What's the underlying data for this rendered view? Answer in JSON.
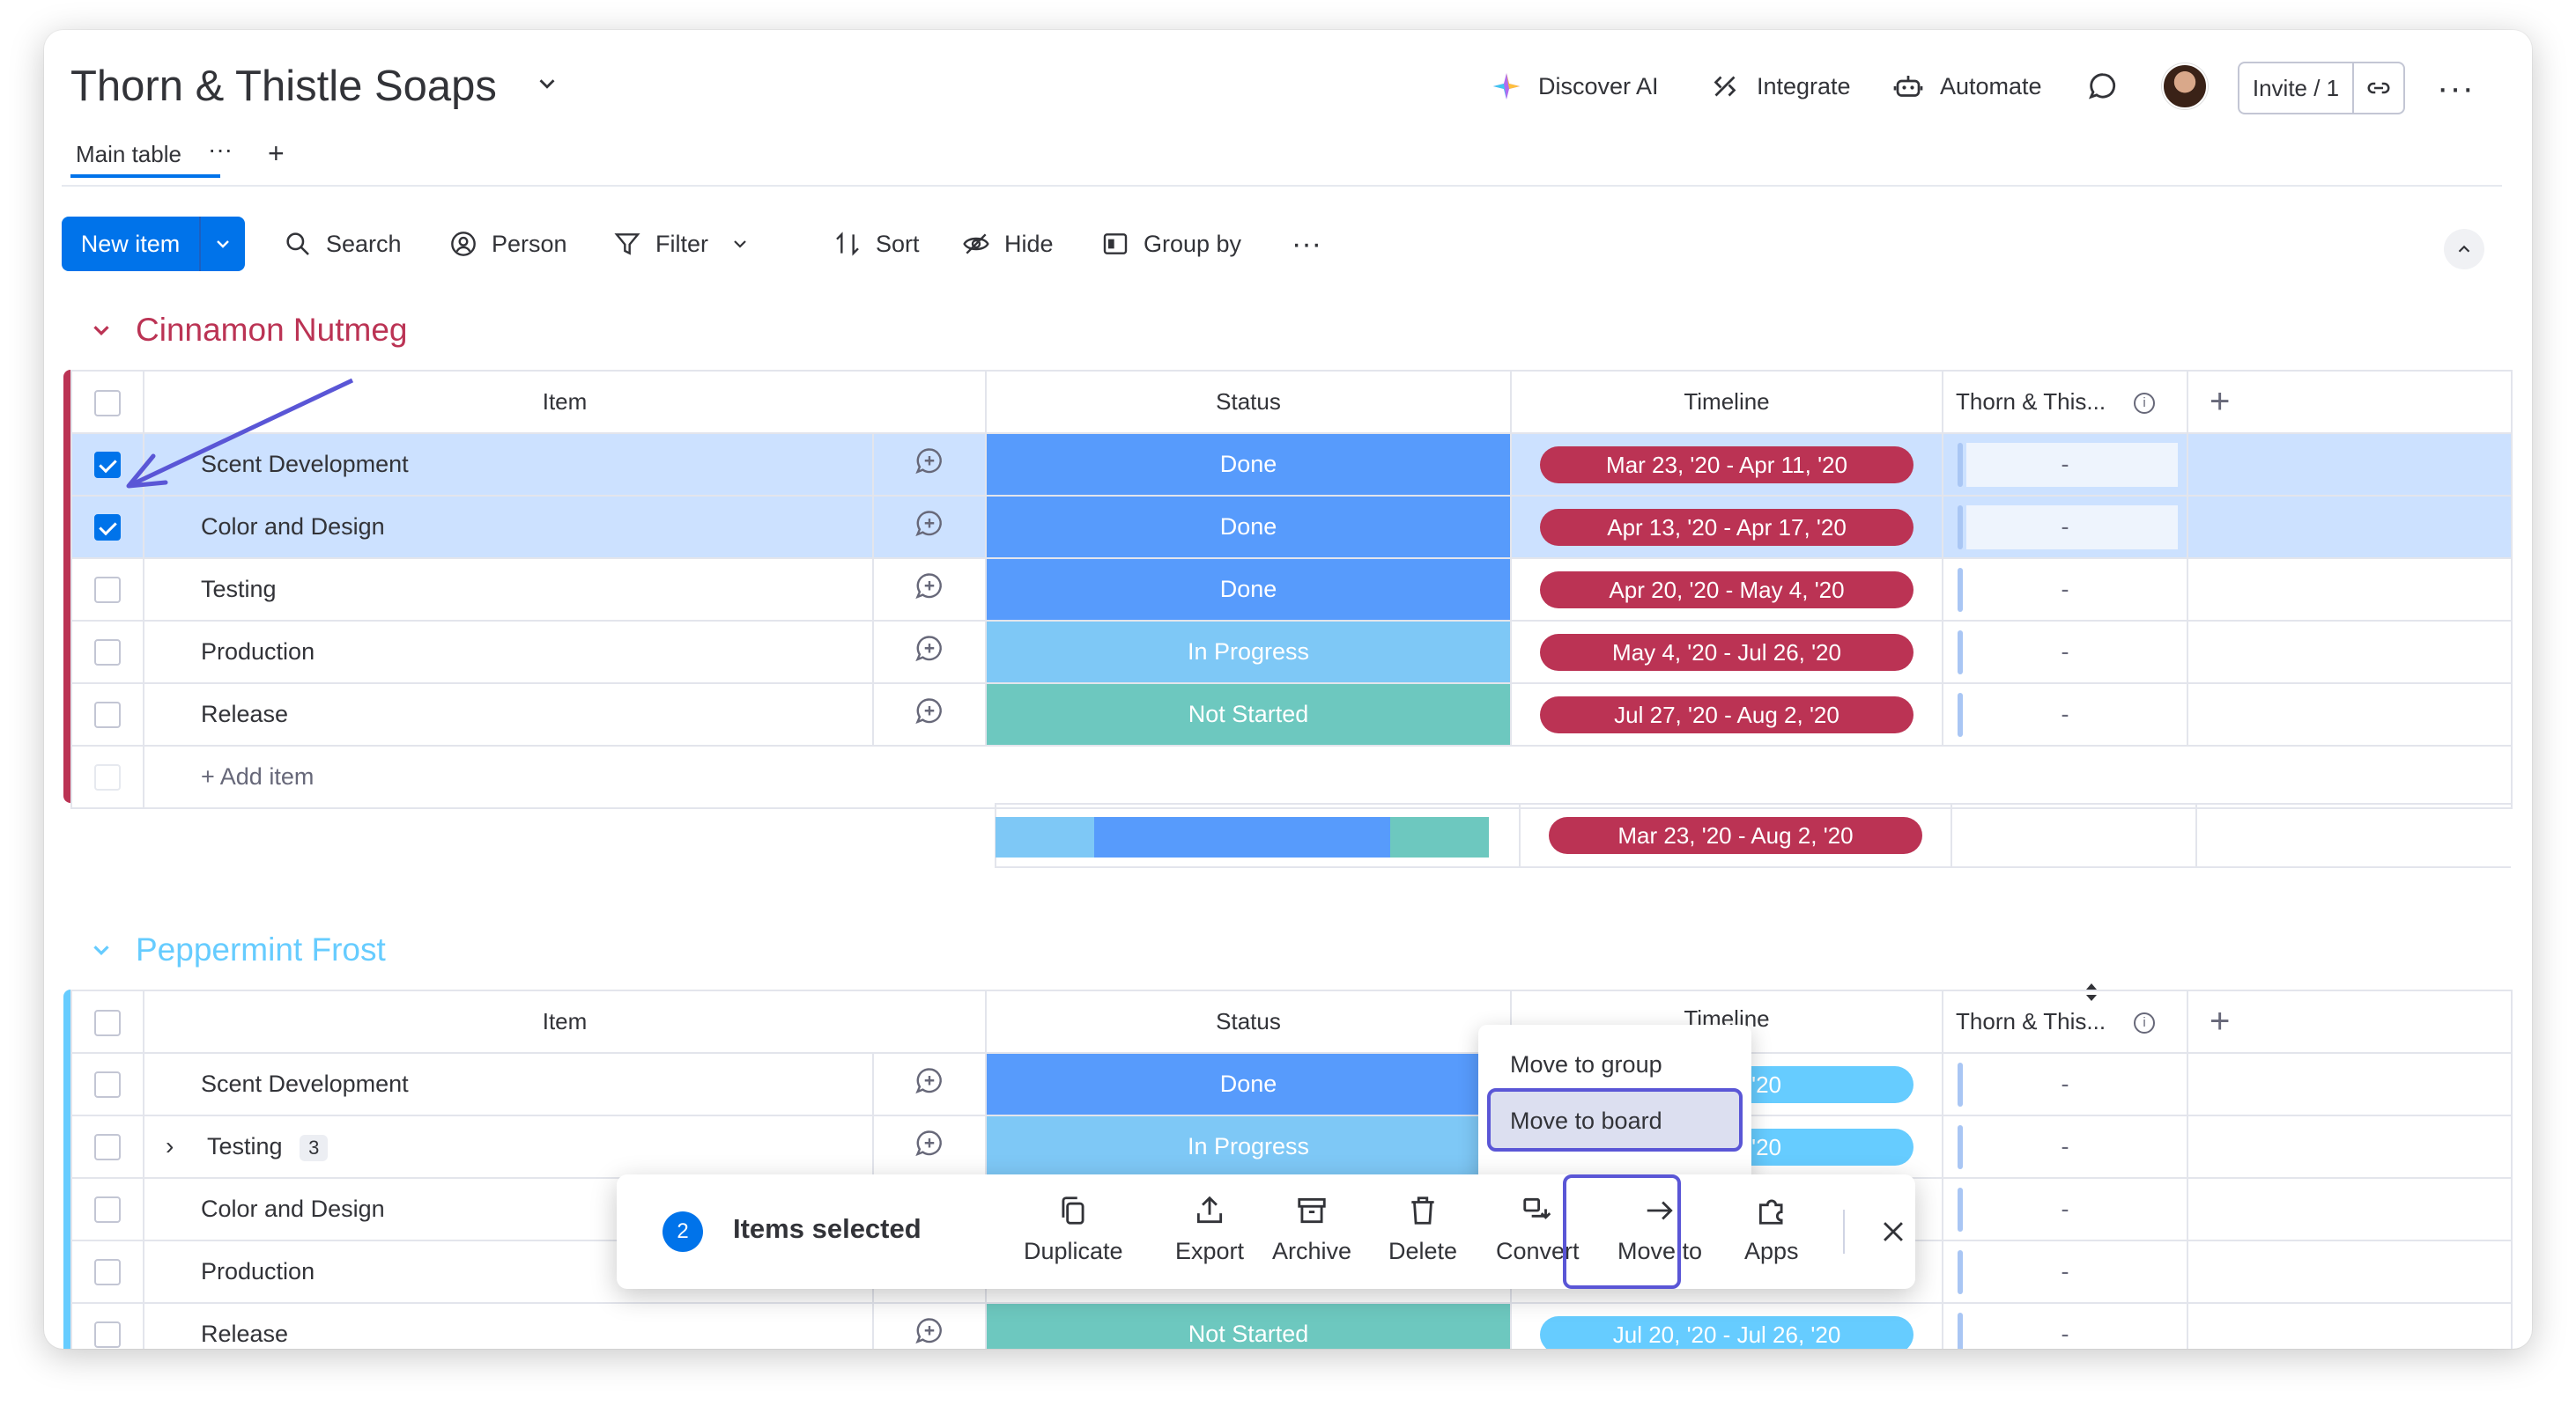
{
  "board": {
    "title": "Thorn & Thistle Soaps"
  },
  "top_actions": {
    "discover_ai": "Discover AI",
    "integrate": "Integrate",
    "automate": "Automate",
    "invite": "Invite / 1"
  },
  "tabs": [
    {
      "label": "Main table"
    }
  ],
  "toolbar": {
    "new_item": "New item",
    "search": "Search",
    "person": "Person",
    "filter": "Filter",
    "sort": "Sort",
    "hide": "Hide",
    "group_by": "Group by"
  },
  "columns": {
    "item": "Item",
    "status": "Status",
    "timeline": "Timeline",
    "dependency": "Thorn & This..."
  },
  "colors": {
    "accent": "#0073ea",
    "done": "#579bfc",
    "in_progress": "#7ec8f6",
    "not_started": "#6dc8bf",
    "group1": "#bb3354",
    "group2": "#66ccff",
    "timeline_red": "#bb3354",
    "timeline_blue": "#66ccff",
    "highlight": "#5a56d6"
  },
  "groups": [
    {
      "title": "Cinnamon Nutmeg",
      "rows": [
        {
          "name": "Scent Development",
          "status": "Done",
          "timeline": "Mar 23, '20 - Apr 11, '20",
          "dep": "-",
          "selected": true
        },
        {
          "name": "Color and Design",
          "status": "Done",
          "timeline": "Apr 13, '20 - Apr 17, '20",
          "dep": "-",
          "selected": true
        },
        {
          "name": "Testing",
          "status": "Done",
          "timeline": "Apr 20, '20 - May 4, '20",
          "dep": "-",
          "selected": false
        },
        {
          "name": "Production",
          "status": "In Progress",
          "timeline": "May 4, '20 - Jul 26, '20",
          "dep": "-",
          "selected": false
        },
        {
          "name": "Release",
          "status": "Not Started",
          "timeline": "Jul 27, '20 - Aug 2, '20",
          "dep": "-",
          "selected": false
        }
      ],
      "add_item": "+ Add item",
      "summary_timeline": "Mar 23, '20 - Aug 2, '20"
    },
    {
      "title": "Peppermint Frost",
      "timeline_header": "Timeline",
      "rows": [
        {
          "name": "Scent Development",
          "status": "Done",
          "timeline": "ay 1, '20",
          "dep": "-"
        },
        {
          "name": "Testing",
          "subitems": "3",
          "status": "In Progress",
          "timeline": "y 27, '20",
          "dep": "-"
        },
        {
          "name": "Color and Design",
          "dep": "-"
        },
        {
          "name": "Production",
          "dep": "-"
        },
        {
          "name": "Release",
          "status": "Not Started",
          "timeline": "Jul 20, '20 - Jul 26, '20",
          "dep": "-"
        }
      ]
    }
  ],
  "bulk_actions": {
    "count": "2",
    "label": "Items selected",
    "duplicate": "Duplicate",
    "export": "Export",
    "archive": "Archive",
    "delete": "Delete",
    "convert": "Convert",
    "move_to": "Move to",
    "apps": "Apps"
  },
  "move_menu": {
    "to_group": "Move to group",
    "to_board": "Move to board"
  }
}
